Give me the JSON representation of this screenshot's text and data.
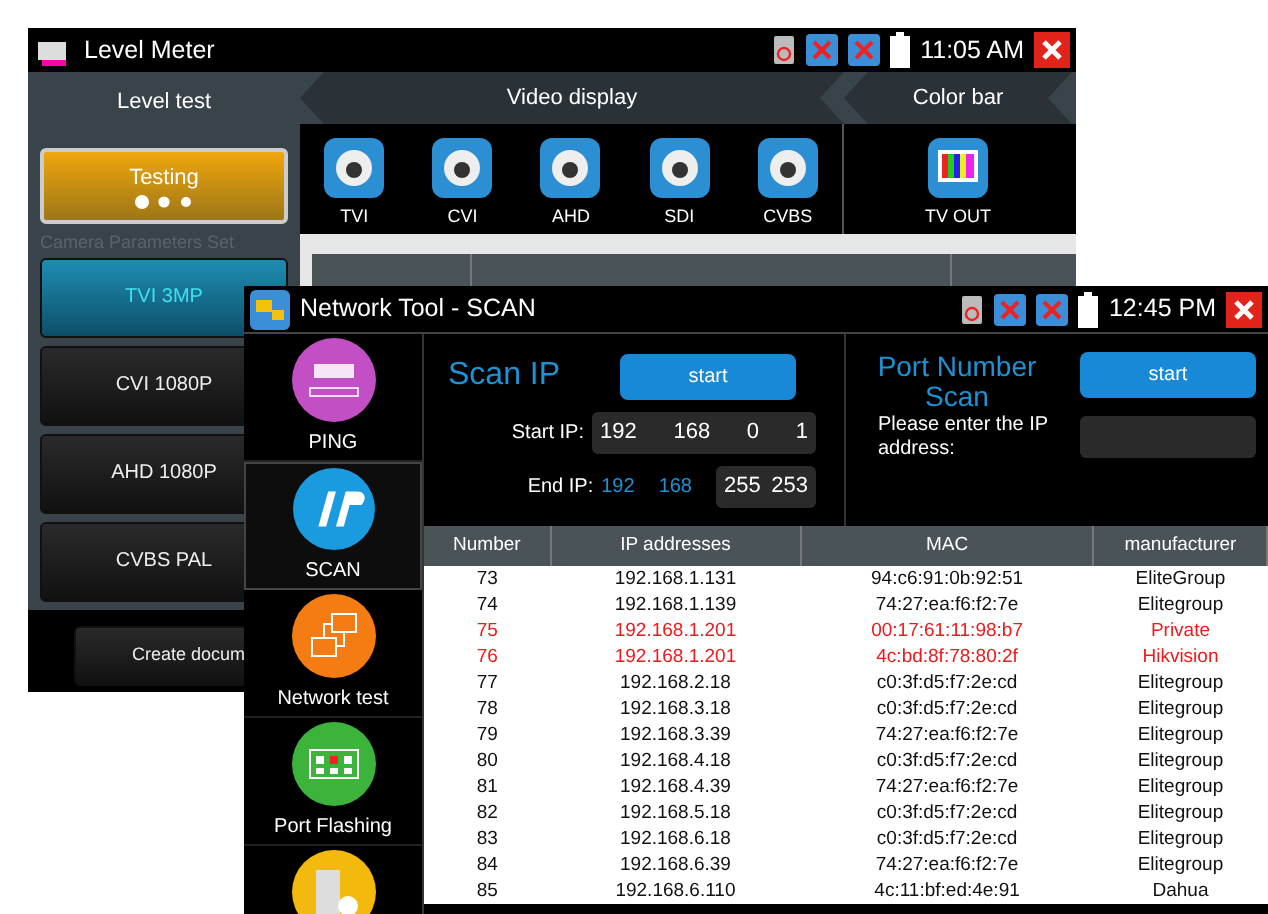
{
  "back_window": {
    "title": "Level Meter",
    "time": "11:05 AM",
    "left_panel": {
      "header": "Level test",
      "testing_button": "Testing",
      "caption": "Camera Parameters Set",
      "presets": [
        {
          "label": "TVI 3MP",
          "selected": true
        },
        {
          "label": "CVI 1080P",
          "selected": false
        },
        {
          "label": "AHD 1080P",
          "selected": false
        },
        {
          "label": "CVBS PAL",
          "selected": false
        }
      ],
      "create_button": "Create docum"
    },
    "sections": [
      {
        "title": "Video display",
        "items": [
          "TVI",
          "CVI",
          "AHD",
          "SDI",
          "CVBS"
        ]
      },
      {
        "title": "Color bar",
        "items": [
          "TV OUT"
        ]
      }
    ]
  },
  "front_window": {
    "title": "Network Tool - SCAN",
    "time": "12:45 PM",
    "sidebar": [
      {
        "label": "PING",
        "color": "#c24fc4",
        "selected": false
      },
      {
        "label": "SCAN",
        "color": "#1a9be0",
        "selected": true
      },
      {
        "label": "Network test",
        "color": "#f57c12",
        "selected": false
      },
      {
        "label": "Port Flashing",
        "color": "#3cb43c",
        "selected": false
      },
      {
        "color": "#f3b90c",
        "selected": false
      }
    ],
    "scan_ip": {
      "title": "Scan IP",
      "button": "start",
      "start_label": "Start IP:",
      "start_ip": [
        "192",
        "168",
        "0",
        "1"
      ],
      "end_label": "End IP:",
      "end_fixed": [
        "192",
        "168"
      ],
      "end_ip": [
        "255",
        "253"
      ]
    },
    "port_scan": {
      "title": "Port Number Scan",
      "button": "start",
      "prompt": "Please enter the IP address:"
    },
    "table": {
      "columns": [
        "Number",
        "IP addresses",
        "MAC",
        "manufacturer"
      ],
      "rows": [
        {
          "cells": [
            "73",
            "192.168.1.131",
            "94:c6:91:0b:92:51",
            "EliteGroup"
          ],
          "highlighted": false
        },
        {
          "cells": [
            "74",
            "192.168.1.139",
            "74:27:ea:f6:f2:7e",
            "Elitegroup"
          ],
          "highlighted": false
        },
        {
          "cells": [
            "75",
            "192.168.1.201",
            "00:17:61:11:98:b7",
            "Private"
          ],
          "highlighted": true
        },
        {
          "cells": [
            "76",
            "192.168.1.201",
            "4c:bd:8f:78:80:2f",
            "Hikvision"
          ],
          "highlighted": true
        },
        {
          "cells": [
            "77",
            "192.168.2.18",
            "c0:3f:d5:f7:2e:cd",
            "Elitegroup"
          ],
          "highlighted": false
        },
        {
          "cells": [
            "78",
            "192.168.3.18",
            "c0:3f:d5:f7:2e:cd",
            "Elitegroup"
          ],
          "highlighted": false
        },
        {
          "cells": [
            "79",
            "192.168.3.39",
            "74:27:ea:f6:f2:7e",
            "Elitegroup"
          ],
          "highlighted": false
        },
        {
          "cells": [
            "80",
            "192.168.4.18",
            "c0:3f:d5:f7:2e:cd",
            "Elitegroup"
          ],
          "highlighted": false
        },
        {
          "cells": [
            "81",
            "192.168.4.39",
            "74:27:ea:f6:f2:7e",
            "Elitegroup"
          ],
          "highlighted": false
        },
        {
          "cells": [
            "82",
            "192.168.5.18",
            "c0:3f:d5:f7:2e:cd",
            "Elitegroup"
          ],
          "highlighted": false
        },
        {
          "cells": [
            "83",
            "192.168.6.18",
            "c0:3f:d5:f7:2e:cd",
            "Elitegroup"
          ],
          "highlighted": false
        },
        {
          "cells": [
            "84",
            "192.168.6.39",
            "74:27:ea:f6:f2:7e",
            "Elitegroup"
          ],
          "highlighted": false
        },
        {
          "cells": [
            "85",
            "192.168.6.110",
            "4c:11:bf:ed:4e:91",
            "Dahua"
          ],
          "highlighted": false
        }
      ]
    }
  }
}
